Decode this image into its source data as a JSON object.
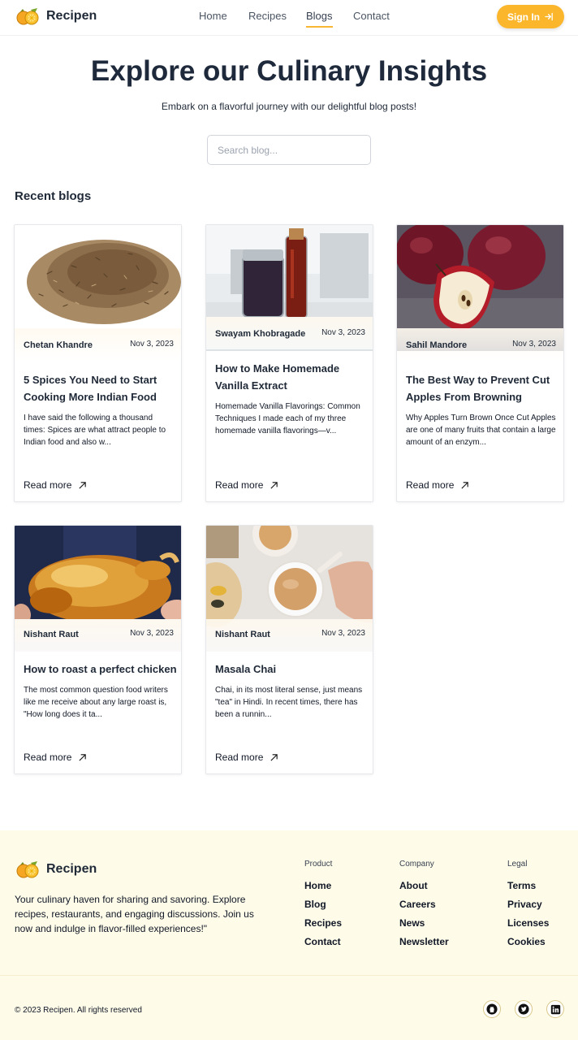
{
  "brand": {
    "name": "Recipen"
  },
  "nav": {
    "items": [
      {
        "label": "Home"
      },
      {
        "label": "Recipes"
      },
      {
        "label": "Blogs",
        "active": true
      },
      {
        "label": "Contact"
      }
    ],
    "sign_in_label": "Sign In"
  },
  "hero": {
    "title": "Explore our Culinary Insights",
    "subtitle": "Embark on a flavorful journey with our delightful blog posts!",
    "search_placeholder": "Search blog..."
  },
  "section": {
    "title": "Recent blogs"
  },
  "cards": [
    {
      "author": "Chetan Khandre",
      "date": "Nov 3, 2023",
      "title": "5 Spices You Need to Start Cooking More Indian Food",
      "excerpt": "I have said the following a thousand times: Spices are what attract people to Indian food and also w...",
      "read_more": "Read more",
      "image": "cumin-seeds"
    },
    {
      "author": "Swayam Khobragade",
      "date": "Nov 3, 2023",
      "title": "How to Make Homemade Vanilla Extract",
      "excerpt": "Homemade Vanilla Flavorings: Common Techniques I made each of my three homemade vanilla flavorings—v...",
      "read_more": "Read more",
      "image": "vanilla-bottles"
    },
    {
      "author": "Sahil Mandore",
      "date": "Nov 3, 2023",
      "title": "The Best Way to Prevent Cut Apples From Browning",
      "excerpt": "Why Apples Turn Brown Once Cut Apples are one of many fruits that contain a large amount of an enzym...",
      "read_more": "Read more",
      "image": "red-apples"
    },
    {
      "author": "Nishant Raut",
      "date": "Nov 3, 2023",
      "title": "How to roast a perfect chicken",
      "excerpt": "The most common question food writers like me receive about any large roast is, \"How long does it ta...",
      "read_more": "Read more",
      "image": "roast-chicken"
    },
    {
      "author": "Nishant Raut",
      "date": "Nov 3, 2023",
      "title": "Masala Chai",
      "excerpt": "Chai, in its most literal sense, just means \"tea\" in Hindi. In recent times, there has been a runnin...",
      "read_more": "Read more",
      "image": "masala-chai"
    }
  ],
  "footer": {
    "description": "Your culinary haven for sharing and savoring. Explore recipes, restaurants, and engaging discussions. Join us now and indulge in flavor-filled experiences!\"",
    "columns": [
      {
        "heading": "Product",
        "links": [
          "Home",
          "Blog",
          "Recipes",
          "Contact"
        ]
      },
      {
        "heading": "Company",
        "links": [
          "About",
          "Careers",
          "News",
          "Newsletter"
        ]
      },
      {
        "heading": "Legal",
        "links": [
          "Terms",
          "Privacy",
          "Licenses",
          "Cookies"
        ]
      }
    ],
    "copyright": "© 2023 Recipen. All rights reserved",
    "social": [
      "github-icon",
      "twitter-icon",
      "linkedin-icon"
    ]
  },
  "colors": {
    "accent": "#fbb62b",
    "footer_bg": "#fefbe8",
    "title": "#1e293b"
  }
}
